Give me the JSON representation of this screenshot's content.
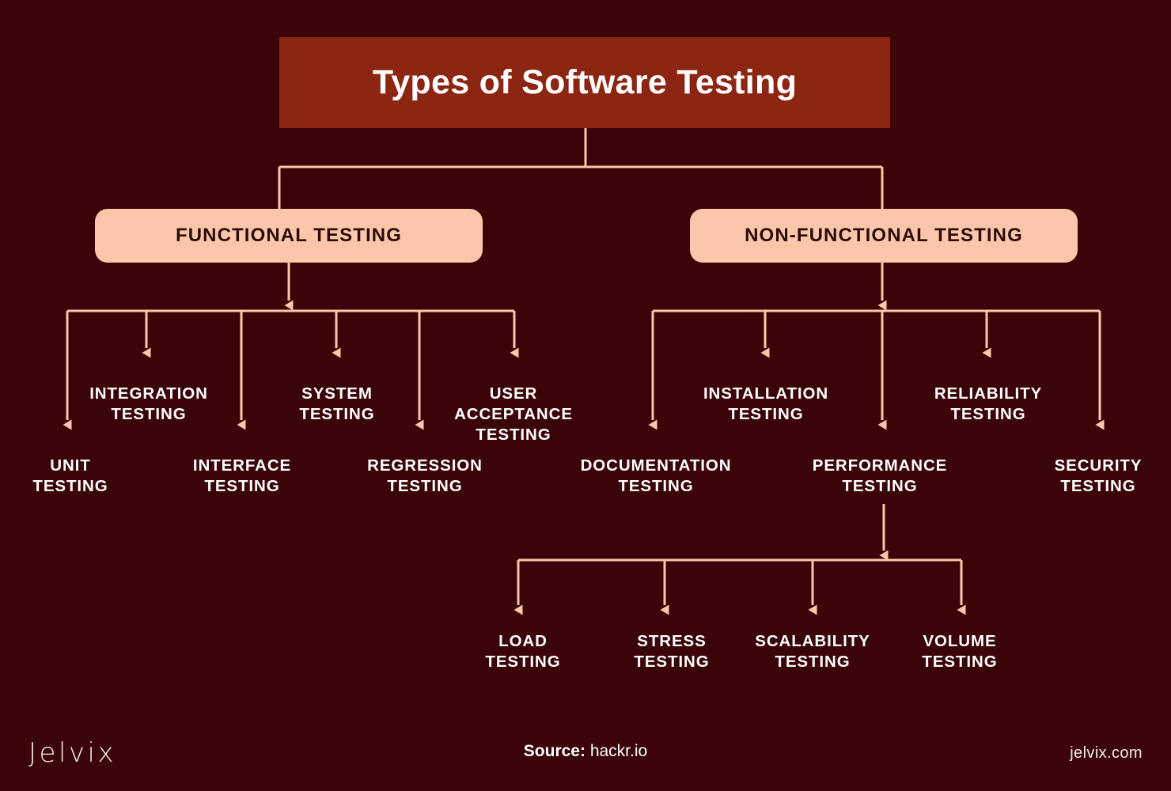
{
  "colors": {
    "background": "#3a0408",
    "title_fill": "#8c2512",
    "title_text": "#ffffff",
    "box_fill": "#fcc6ab",
    "box_text": "#2b0b08",
    "connector": "#fcc6ab",
    "leaf_text": "#ffffff"
  },
  "title": "Types of Software Testing",
  "categories": {
    "functional": "FUNCTIONAL TESTING",
    "non_functional": "NON-FUNCTIONAL TESTING"
  },
  "functional_children": [
    {
      "label": "UNIT\nTESTING"
    },
    {
      "label": "INTEGRATION\nTESTING"
    },
    {
      "label": "INTERFACE\nTESTING"
    },
    {
      "label": "SYSTEM\nTESTING"
    },
    {
      "label": "REGRESSION\nTESTING"
    },
    {
      "label": "USER\nACCEPTANCE\nTESTING"
    }
  ],
  "non_functional_children": [
    {
      "label": "DOCUMENTATION\nTESTING"
    },
    {
      "label": "INSTALLATION\nTESTING"
    },
    {
      "label": "PERFORMANCE\nTESTING"
    },
    {
      "label": "RELIABILITY\nTESTING"
    },
    {
      "label": "SECURITY\nTESTING"
    }
  ],
  "performance_children": [
    {
      "label": "LOAD\nTESTING"
    },
    {
      "label": "STRESS\nTESTING"
    },
    {
      "label": "SCALABILITY\nTESTING"
    },
    {
      "label": "VOLUME\nTESTING"
    }
  ],
  "footer": {
    "logo": "Jelvix",
    "source_label": "Source:",
    "source_value": "hackr.io",
    "site": "jelvix.com"
  }
}
